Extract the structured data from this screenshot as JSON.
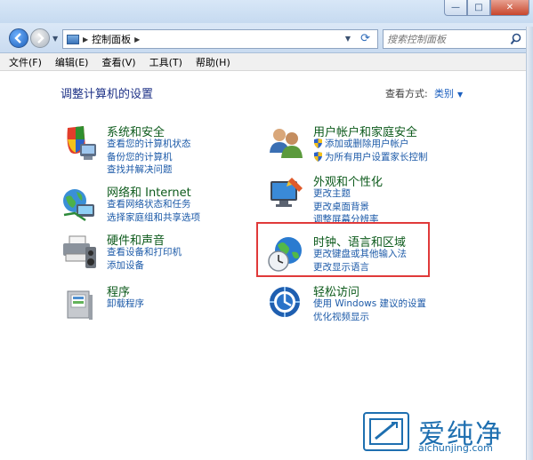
{
  "window": {
    "caption": {
      "minimize": "—",
      "maximize": "□",
      "close": "✕"
    }
  },
  "nav": {
    "breadcrumb": "控制面板",
    "search_placeholder": "搜索控制面板"
  },
  "menu": [
    "文件(F)",
    "编辑(E)",
    "查看(V)",
    "工具(T)",
    "帮助(H)"
  ],
  "page": {
    "title": "调整计算机的设置",
    "viewby_label": "查看方式:",
    "viewby_value": "类别"
  },
  "categories": [
    {
      "title": "系统和安全",
      "links": [
        "查看您的计算机状态",
        "备份您的计算机",
        "查找并解决问题"
      ],
      "icon": "shield-computer-icon"
    },
    {
      "title": "网络和 Internet",
      "links": [
        "查看网络状态和任务",
        "选择家庭组和共享选项"
      ],
      "icon": "network-globe-icon"
    },
    {
      "title": "硬件和声音",
      "links": [
        "查看设备和打印机",
        "添加设备"
      ],
      "icon": "printer-speaker-icon"
    },
    {
      "title": "程序",
      "links": [
        "卸载程序"
      ],
      "icon": "programs-box-icon"
    },
    {
      "title": "用户帐户和家庭安全",
      "links": [
        "添加或删除用户帐户",
        "为所有用户设置家长控制"
      ],
      "icon": "users-icon"
    },
    {
      "title": "外观和个性化",
      "links": [
        "更改主题",
        "更改桌面背景",
        "调整屏幕分辨率"
      ],
      "icon": "monitor-brush-icon"
    },
    {
      "title": "时钟、语言和区域",
      "links": [
        "更改键盘或其他输入法",
        "更改显示语言"
      ],
      "icon": "globe-clock-icon"
    },
    {
      "title": "轻松访问",
      "links": [
        "使用 Windows 建议的设置",
        "优化视频显示"
      ],
      "icon": "ease-of-access-icon"
    }
  ],
  "watermark": {
    "text": "爱纯净",
    "url": "aichunjing.com"
  },
  "colors": {
    "category_title": "#0c5a1b",
    "link": "#1c5aa8",
    "highlight": "#e03a3a"
  }
}
